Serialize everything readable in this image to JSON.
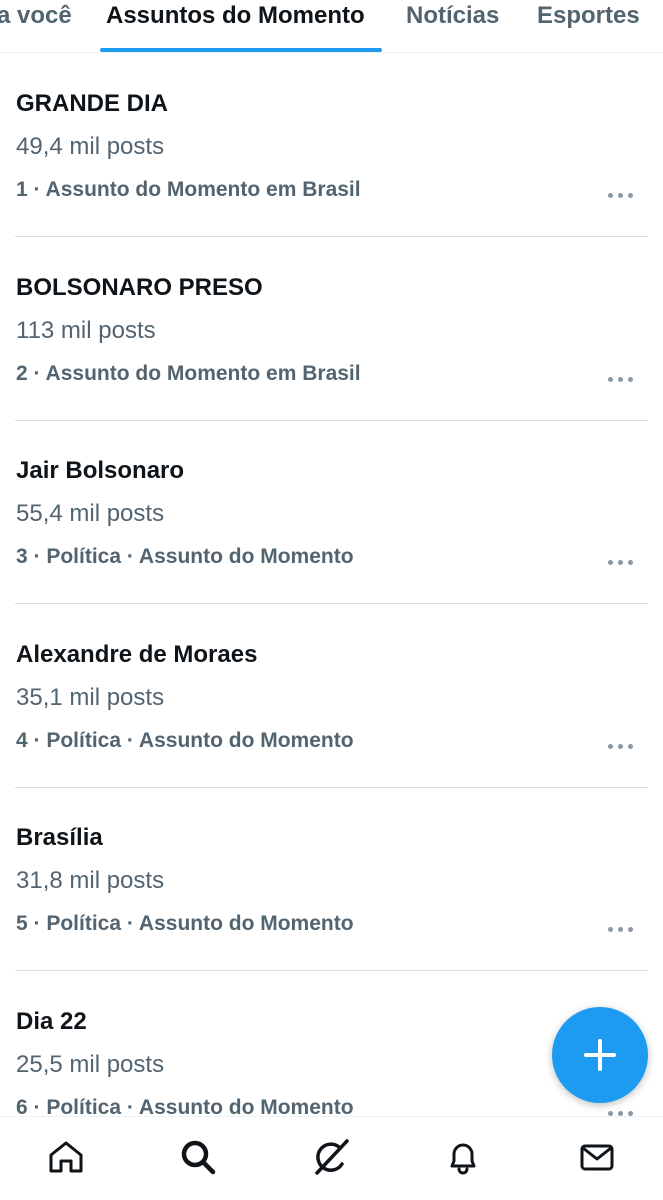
{
  "tabs": [
    {
      "label": "a você",
      "active": false
    },
    {
      "label": "Assuntos do Momento",
      "active": true
    },
    {
      "label": "Notícias",
      "active": false
    },
    {
      "label": "Esportes",
      "active": false
    }
  ],
  "trends": [
    {
      "name": "GRANDE DIA",
      "count": "49,4 mil posts",
      "meta": "1 · Assunto do Momento em Brasil"
    },
    {
      "name": "BOLSONARO PRESO",
      "count": "113 mil posts",
      "meta": "2 · Assunto do Momento em Brasil"
    },
    {
      "name": "Jair Bolsonaro",
      "count": "55,4 mil posts",
      "meta": "3 · Política · Assunto do Momento"
    },
    {
      "name": "Alexandre de Moraes",
      "count": "35,1 mil posts",
      "meta": "4 · Política · Assunto do Momento"
    },
    {
      "name": "Brasília",
      "count": "31,8 mil posts",
      "meta": "5 · Política · Assunto do Momento"
    },
    {
      "name": "Dia 22",
      "count": "25,5 mil posts",
      "meta": "6 · Política · Assunto do Momento"
    }
  ],
  "icons": {
    "more": "more-options-icon",
    "compose": "plus-icon",
    "nav": [
      "home-icon",
      "search-icon",
      "grok-icon",
      "bell-icon",
      "mail-icon"
    ]
  },
  "colors": {
    "accent": "#1d9bf0",
    "text_primary": "#0f1419",
    "text_secondary": "#536471",
    "divider": "#d9dee1"
  }
}
